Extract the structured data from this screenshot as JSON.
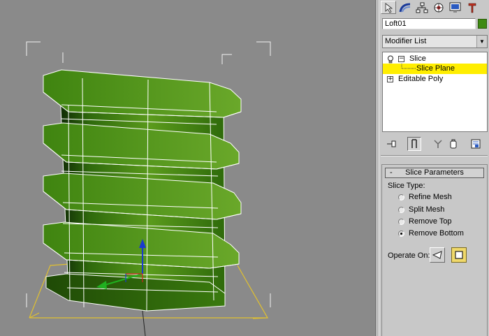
{
  "viewport": {
    "object_color": "#4a8a14",
    "wire_color": "#ffffff",
    "background_color": "#8a8a8a"
  },
  "command_panel": {
    "tabs": [
      {
        "icon": "create-icon",
        "active": true
      },
      {
        "icon": "modify-icon",
        "active": false
      },
      {
        "icon": "hierarchy-icon",
        "active": false
      },
      {
        "icon": "motion-icon",
        "active": false
      },
      {
        "icon": "display-icon",
        "active": false
      },
      {
        "icon": "utilities-icon",
        "active": false
      }
    ],
    "object_name": "Loft01",
    "object_color": "#3f8a12",
    "modifier_list": "Modifier List",
    "stack": [
      {
        "label": "Slice",
        "type": "modifier",
        "expanded": true
      },
      {
        "label": "Slice Plane",
        "type": "sub-object",
        "selected": true
      },
      {
        "label": "Editable Poly",
        "type": "base",
        "expanded": false
      }
    ],
    "stack_tools": [
      "pin-stack-icon",
      "show-end-result-icon",
      "make-unique-icon",
      "remove-modifier-icon",
      "configure-modifier-sets-icon"
    ]
  },
  "slice_parameters": {
    "title": "Slice Parameters",
    "collapse_glyph": "-",
    "slice_type_label": "Slice Type:",
    "options": [
      {
        "label": "Refine Mesh",
        "checked": false
      },
      {
        "label": "Split Mesh",
        "checked": false
      },
      {
        "label": "Remove Top",
        "checked": false
      },
      {
        "label": "Remove Bottom",
        "checked": true
      }
    ],
    "operate_on_label": "Operate On:",
    "operate_on": [
      {
        "icon": "face-icon",
        "active": false
      },
      {
        "icon": "polygon-icon",
        "active": true
      }
    ]
  }
}
